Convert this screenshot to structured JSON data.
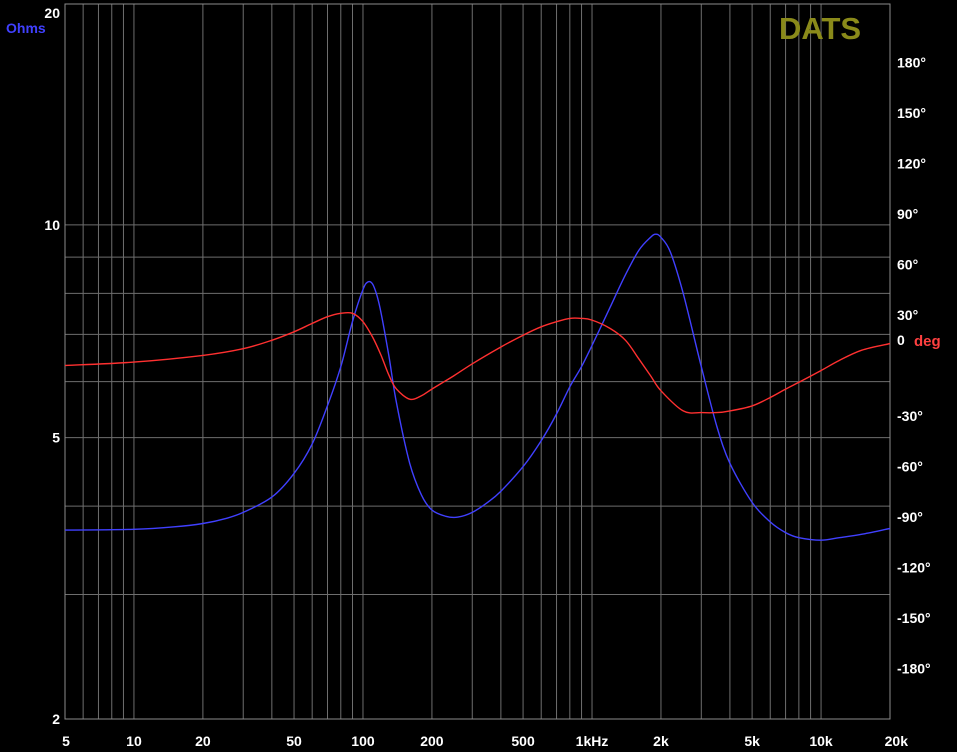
{
  "chart_data": {
    "type": "line",
    "brand": "DATS",
    "left_axis": {
      "unit": "Ohms",
      "scale": "log",
      "range": [
        2,
        20
      ],
      "ticks": [
        {
          "value": 20,
          "label": "20"
        },
        {
          "value": 10,
          "label": "10"
        },
        {
          "value": 5,
          "label": "5"
        },
        {
          "value": 2,
          "label": "2"
        }
      ]
    },
    "right_axis": {
      "zero_label": "0",
      "unit": "deg",
      "range": [
        -210,
        210
      ],
      "ticks": [
        {
          "value": 180,
          "label": "180°"
        },
        {
          "value": 150,
          "label": "150°"
        },
        {
          "value": 120,
          "label": "120°"
        },
        {
          "value": 90,
          "label": "90°"
        },
        {
          "value": 60,
          "label": "60°"
        },
        {
          "value": 30,
          "label": "30°"
        },
        {
          "value": -30,
          "label": "-30°"
        },
        {
          "value": -60,
          "label": "-60°"
        },
        {
          "value": -90,
          "label": "-90°"
        },
        {
          "value": -120,
          "label": "-120°"
        },
        {
          "value": -150,
          "label": "-150°"
        },
        {
          "value": -180,
          "label": "-180°"
        }
      ]
    },
    "x_axis": {
      "scale": "log",
      "range": [
        5,
        20000
      ],
      "ticks": [
        {
          "value": 5,
          "label": "5"
        },
        {
          "value": 10,
          "label": "10"
        },
        {
          "value": 20,
          "label": "20"
        },
        {
          "value": 50,
          "label": "50"
        },
        {
          "value": 100,
          "label": "100"
        },
        {
          "value": 200,
          "label": "200"
        },
        {
          "value": 500,
          "label": "500"
        },
        {
          "value": 1000,
          "label": "1kHz"
        },
        {
          "value": 2000,
          "label": "2k"
        },
        {
          "value": 5000,
          "label": "5k"
        },
        {
          "value": 10000,
          "label": "10k"
        },
        {
          "value": 20000,
          "label": "20k"
        }
      ]
    },
    "grid": true,
    "series": [
      {
        "axis": "left",
        "color": "#4040ff",
        "x": [
          5,
          10,
          15,
          20,
          25,
          30,
          40,
          50,
          60,
          70,
          80,
          90,
          100,
          105,
          110,
          115,
          120,
          130,
          140,
          160,
          180,
          200,
          230,
          260,
          300,
          350,
          400,
          500,
          600,
          700,
          800,
          900,
          1000,
          1200,
          1400,
          1600,
          1800,
          1900,
          2000,
          2200,
          2500,
          3000,
          3500,
          4000,
          5000,
          6000,
          7000,
          8000,
          10000,
          12000,
          15000,
          20000
        ],
        "y": [
          3.7,
          3.71,
          3.74,
          3.78,
          3.84,
          3.92,
          4.12,
          4.45,
          4.9,
          5.55,
          6.3,
          7.3,
          8.1,
          8.3,
          8.25,
          7.95,
          7.5,
          6.5,
          5.6,
          4.6,
          4.15,
          3.95,
          3.87,
          3.86,
          3.92,
          4.05,
          4.2,
          4.55,
          4.95,
          5.4,
          5.9,
          6.3,
          6.75,
          7.65,
          8.5,
          9.2,
          9.6,
          9.7,
          9.6,
          9.15,
          8.0,
          6.3,
          5.2,
          4.6,
          4.05,
          3.8,
          3.67,
          3.61,
          3.58,
          3.61,
          3.65,
          3.72
        ]
      },
      {
        "axis": "right",
        "color": "#ff3030",
        "x": [
          5,
          10,
          20,
          30,
          40,
          50,
          60,
          70,
          80,
          90,
          100,
          110,
          120,
          130,
          140,
          160,
          180,
          200,
          250,
          300,
          400,
          500,
          600,
          700,
          800,
          900,
          1000,
          1200,
          1400,
          1600,
          1800,
          2000,
          2500,
          3000,
          3500,
          4000,
          5000,
          6000,
          7000,
          8000,
          10000,
          12000,
          15000,
          20000
        ],
        "y": [
          0,
          2,
          6,
          10,
          15,
          20,
          25,
          29,
          31,
          31,
          26,
          17,
          6,
          -6,
          -14,
          -20,
          -18,
          -14,
          -6,
          1,
          11,
          18,
          23,
          26,
          28,
          28,
          27,
          22,
          15,
          4,
          -6,
          -15,
          -27,
          -28,
          -28,
          -27,
          -24,
          -19,
          -14,
          -10,
          -3,
          3,
          9,
          13
        ]
      }
    ]
  }
}
